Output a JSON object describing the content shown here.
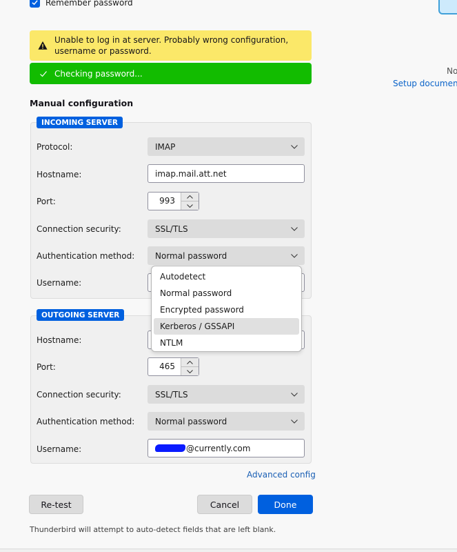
{
  "remember_password": {
    "label": "Remember password",
    "checked": true
  },
  "side_panel": {
    "partial_text": "No",
    "setup_link": "Setup documentat"
  },
  "notifications": {
    "warning": {
      "icon": "warning-triangle-icon",
      "text": "Unable to log in at server. Probably wrong configuration, username or password."
    },
    "status": {
      "icon": "checkmark-icon",
      "text": "Checking password..."
    }
  },
  "manual_config": {
    "title": "Manual configuration",
    "incoming": {
      "legend": "INCOMING SERVER",
      "protocol_label": "Protocol:",
      "protocol": "IMAP",
      "hostname_label": "Hostname:",
      "hostname": "imap.mail.att.net",
      "port_label": "Port:",
      "port": "993",
      "security_label": "Connection security:",
      "security": "SSL/TLS",
      "auth_label": "Authentication method:",
      "auth": "Normal password",
      "username_label": "Username:"
    },
    "auth_dropdown": {
      "options": [
        "Autodetect",
        "Normal password",
        "Encrypted password",
        "Kerberos / GSSAPI",
        "NTLM"
      ],
      "highlighted": "Kerberos / GSSAPI"
    },
    "outgoing": {
      "legend": "OUTGOING SERVER",
      "hostname_label": "Hostname:",
      "port_label": "Port:",
      "port": "465",
      "security_label": "Connection security:",
      "security": "SSL/TLS",
      "auth_label": "Authentication method:",
      "auth": "Normal password",
      "username_label": "Username:",
      "username_visible": "@currently.com"
    },
    "advanced_link": "Advanced config"
  },
  "buttons": {
    "retest": "Re-test",
    "cancel": "Cancel",
    "done": "Done"
  },
  "hint": "Thunderbird will attempt to auto-detect fields that are left blank.",
  "colors": {
    "accent": "#0060df",
    "warning_bg": "#fbe869",
    "success_bg": "#12bc00",
    "link": "#0a63c9"
  }
}
